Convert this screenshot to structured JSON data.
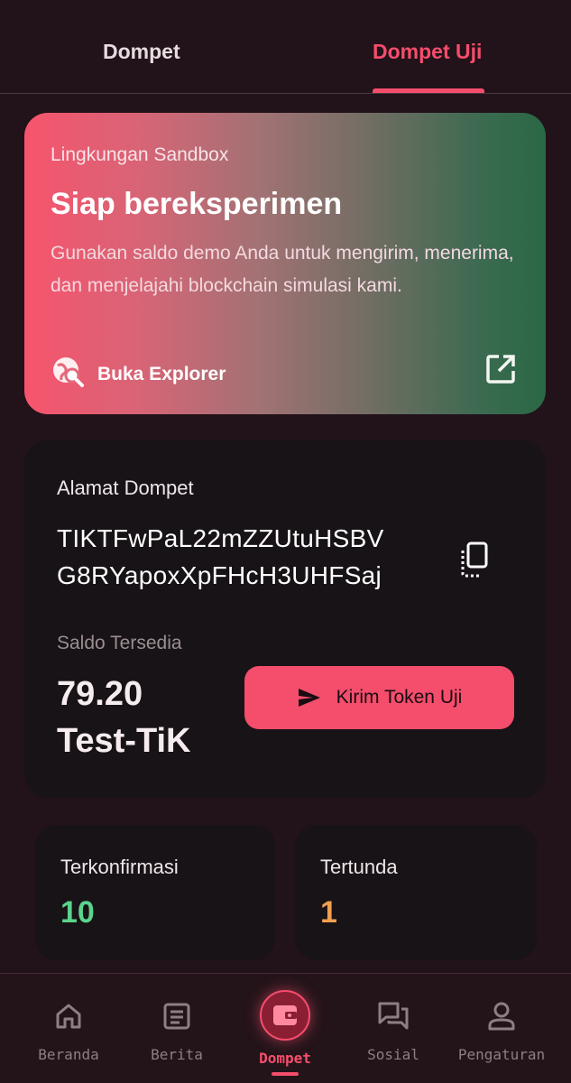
{
  "tabs": {
    "wallet_label": "Dompet",
    "test_wallet_label": "Dompet Uji",
    "active": "Dompet Uji"
  },
  "sandbox": {
    "label": "Lingkungan Sandbox",
    "title": "Siap bereksperimen",
    "description": "Gunakan saldo demo Anda untuk mengirim, menerima, dan menjelajahi blockchain simulasi kami.",
    "explorer_label": "Buka Explorer"
  },
  "wallet": {
    "address_label": "Alamat Dompet",
    "address_line1": "TIKTFwPaL22mZZUtuHSBV",
    "address_line2": "G8RYapoxXpFHcH3UHFSaj",
    "balance_label": "Saldo Tersedia",
    "balance_value": "79.20",
    "balance_unit": "Test-TiK",
    "send_label": "Kirim Token Uji"
  },
  "stats": {
    "confirmed_label": "Terkonfirmasi",
    "confirmed_value": "10",
    "pending_label": "Tertunda",
    "pending_value": "1"
  },
  "nav": {
    "home": "Beranda",
    "news": "Berita",
    "wallet": "Dompet",
    "social": "Sosial",
    "settings": "Pengaturan",
    "active": "Dompet"
  },
  "colors": {
    "accent": "#f54d6c",
    "background": "#221219",
    "card": "#181316",
    "confirmed": "#5ad48c",
    "pending": "#f0a04f"
  },
  "icons": {
    "explorer": "globe-search-icon",
    "external": "external-link-icon",
    "copy": "copy-icon",
    "send": "send-icon",
    "home": "home-icon",
    "news": "article-icon",
    "wallet": "wallet-icon",
    "social": "chat-icon",
    "settings": "person-icon"
  }
}
